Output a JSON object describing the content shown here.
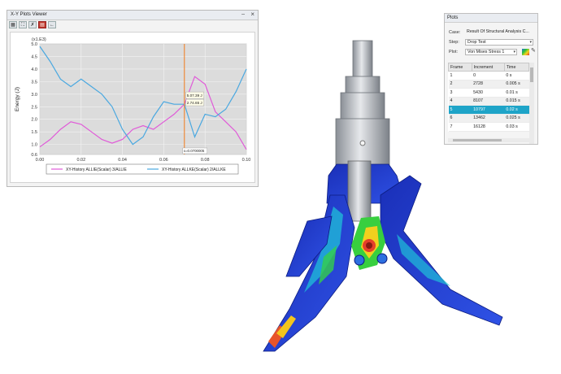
{
  "xy_viewer": {
    "title": "X-Y Plots Viewer",
    "minimize_glyph": "–",
    "close_glyph": "×",
    "toolbar_icons": [
      "grid-icon",
      "fit-icon",
      "delete-icon",
      "chart-icon",
      "back-arrow-icon"
    ],
    "tooltip_a": "5.07.39 J",
    "tooltip_b": "2.74.65 J",
    "cursor_label": "x=0.0700005",
    "accent_color": "#f07a1a"
  },
  "chart_data": {
    "type": "line",
    "title": "",
    "xlabel": "Time (s)",
    "ylabel": "Energy (J)",
    "y_multiplier_label": "(x1.E3)",
    "xlim": [
      0.0,
      0.1
    ],
    "ylim": [
      0.6,
      5.0
    ],
    "x_ticks": [
      "0.00",
      "0.02",
      "0.04",
      "0.06",
      "0.08",
      "0.10"
    ],
    "y_ticks": [
      "0.6",
      "1.0",
      "1.5",
      "2.0",
      "2.5",
      "3.0",
      "3.5",
      "4.0",
      "4.5",
      "5.0"
    ],
    "y_tick_values": [
      0.6,
      1.0,
      1.5,
      2.0,
      2.5,
      3.0,
      3.5,
      4.0,
      4.5,
      5.0
    ],
    "x_tick_values": [
      0.0,
      0.02,
      0.04,
      0.06,
      0.08,
      0.1
    ],
    "grid": true,
    "legend_position": "bottom",
    "cursor_x": 0.07,
    "series": [
      {
        "name": "XY-History ALLIE(Scalar) 3/ALLIE",
        "color": "#e05ad8",
        "x": [
          0.0,
          0.005,
          0.01,
          0.015,
          0.02,
          0.025,
          0.03,
          0.035,
          0.04,
          0.045,
          0.05,
          0.055,
          0.06,
          0.065,
          0.07,
          0.075,
          0.08,
          0.085,
          0.09,
          0.095,
          0.1
        ],
        "y": [
          0.9,
          1.2,
          1.6,
          1.9,
          1.8,
          1.5,
          1.2,
          1.05,
          1.2,
          1.6,
          1.75,
          1.6,
          1.9,
          2.2,
          2.6,
          3.7,
          3.4,
          2.3,
          1.9,
          1.5,
          0.8
        ]
      },
      {
        "name": "XY-History ALLKE(Scalar) 2/ALLKE",
        "color": "#4aa8e0",
        "x": [
          0.0,
          0.005,
          0.01,
          0.015,
          0.02,
          0.025,
          0.03,
          0.035,
          0.04,
          0.045,
          0.05,
          0.055,
          0.06,
          0.065,
          0.07,
          0.075,
          0.08,
          0.085,
          0.09,
          0.095,
          0.1
        ],
        "y": [
          4.9,
          4.3,
          3.6,
          3.3,
          3.6,
          3.3,
          3.0,
          2.5,
          1.6,
          1.0,
          1.3,
          2.1,
          2.7,
          2.6,
          2.6,
          1.3,
          2.2,
          2.1,
          2.4,
          3.1,
          4.0
        ]
      }
    ]
  },
  "plots_panel": {
    "title": "Plots",
    "case_label": "Case:",
    "case_value": "Result Of Structural Analysis C...",
    "step_label": "Step:",
    "step_value": "Drop Test",
    "plot_label": "Plot:",
    "plot_value": "Von Mises Stress 1",
    "columns": [
      "Frame",
      "Increment",
      "Time"
    ],
    "rows": [
      {
        "frame": "1",
        "increment": "0",
        "time": "0 s"
      },
      {
        "frame": "2",
        "increment": "2728",
        "time": "0.005 s"
      },
      {
        "frame": "3",
        "increment": "5430",
        "time": "0.01 s"
      },
      {
        "frame": "4",
        "increment": "8107",
        "time": "0.015 s"
      },
      {
        "frame": "5",
        "increment": "10797",
        "time": "0.02 s"
      },
      {
        "frame": "6",
        "increment": "13462",
        "time": "0.025 s"
      },
      {
        "frame": "7",
        "increment": "16128",
        "time": "0.03 s"
      }
    ],
    "selected_row": 4,
    "selection_color": "#1ea4c8"
  }
}
